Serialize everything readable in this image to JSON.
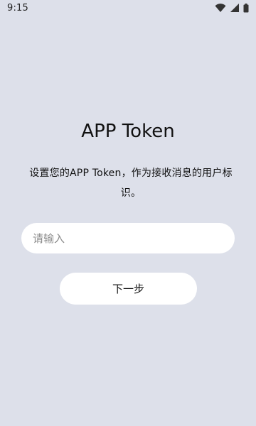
{
  "status_bar": {
    "time": "9:15",
    "icons": [
      "wifi-icon",
      "cellular-signal-icon",
      "battery-icon"
    ]
  },
  "page": {
    "title": "APP Token",
    "description": "设置您的APP Token，作为接收消息的用户标识。",
    "input_placeholder": "请输入",
    "input_value": "",
    "next_button_label": "下一步"
  },
  "colors": {
    "background": "#dde0ea",
    "card": "#ffffff",
    "text": "#111111",
    "placeholder": "#8a8a8a"
  }
}
